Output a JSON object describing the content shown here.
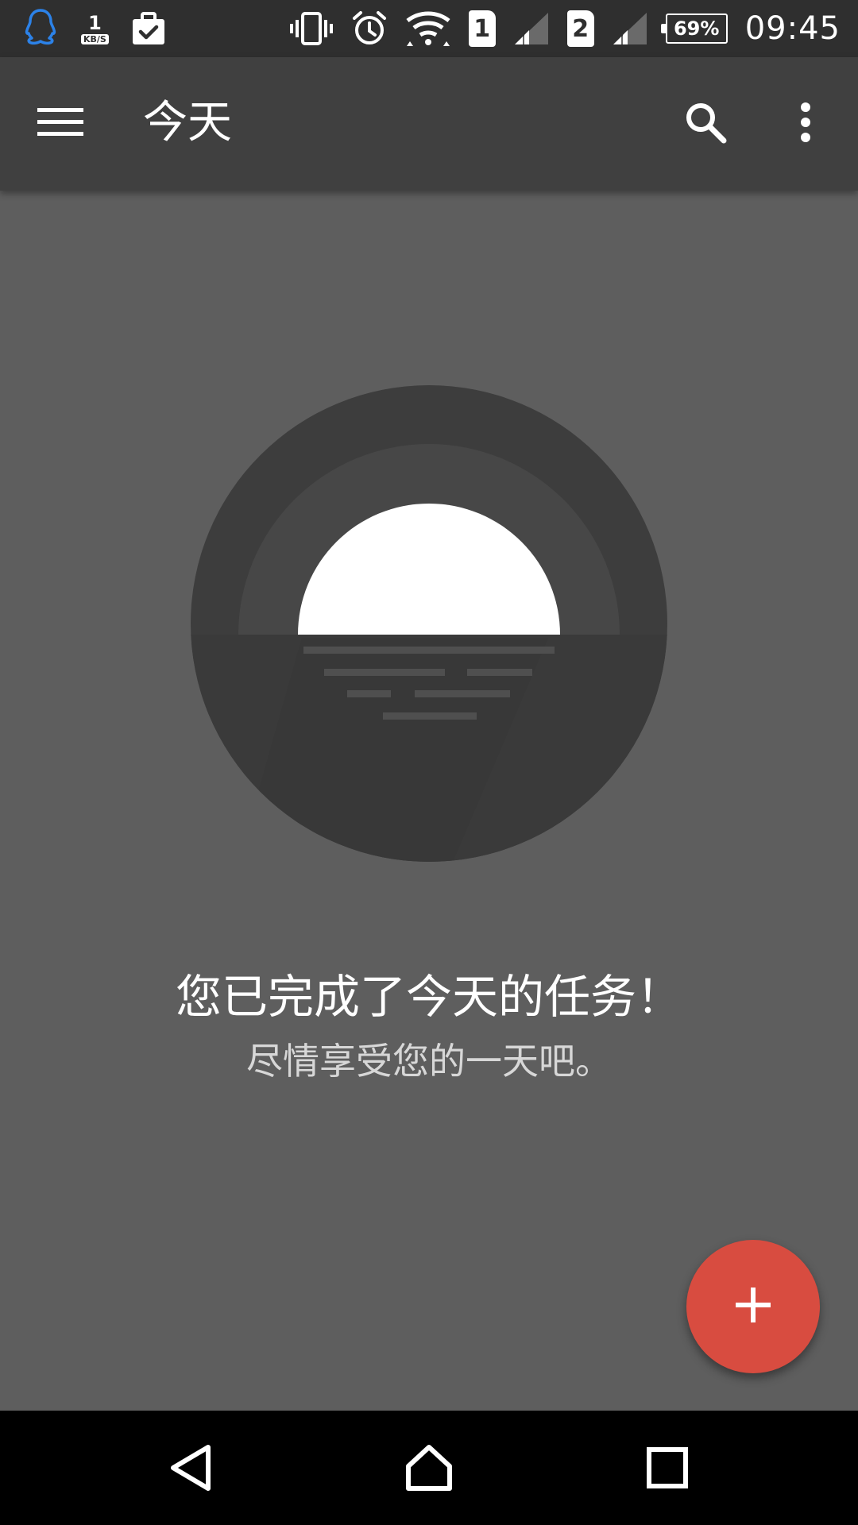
{
  "status_bar": {
    "net_speed_value": "1",
    "net_speed_unit": "KB/S",
    "sim1": "1",
    "sim2": "2",
    "battery": "69%",
    "time": "09:45",
    "icons": [
      "qq-icon",
      "briefcase-check-icon",
      "vibrate-icon",
      "alarm-icon",
      "wifi-icon",
      "signal-icon",
      "signal-icon"
    ]
  },
  "app_bar": {
    "title": "今天",
    "icons": [
      "menu-icon",
      "search-icon",
      "more-vert-icon"
    ]
  },
  "empty_state": {
    "title": "您已完成了今天的任务！",
    "subtitle": "尽情享受您的一天吧。"
  },
  "fab": {
    "icon": "plus-icon",
    "color": "#d84c40"
  },
  "nav_bar": {
    "icons": [
      "back-icon",
      "home-icon",
      "recents-icon"
    ]
  },
  "colors": {
    "background": "#5e5e5e",
    "app_bar": "#404040",
    "status_bar": "#2f2f2f",
    "accent": "#d84c40",
    "qq_blue": "#2c82e8"
  }
}
